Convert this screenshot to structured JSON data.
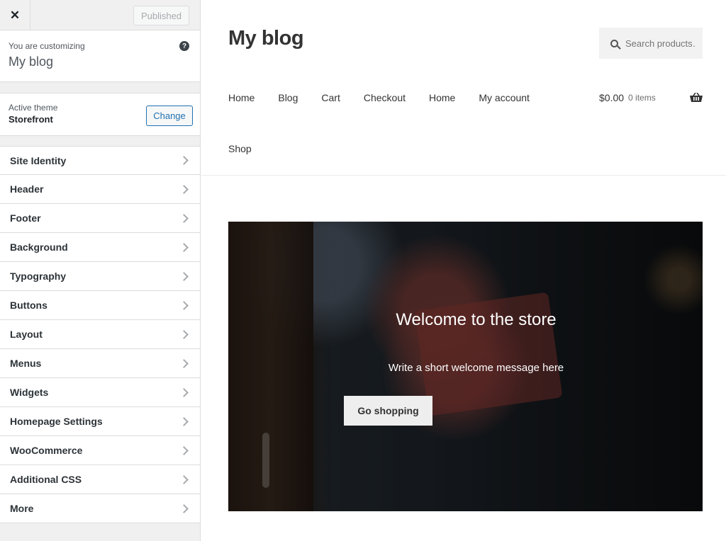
{
  "sidebar": {
    "close_label": "✕",
    "published_label": "Published",
    "customizing_label": "You are customizing",
    "site_name": "My blog",
    "help_label": "?",
    "active_theme_label": "Active theme",
    "theme_name": "Storefront",
    "change_label": "Change",
    "panels": [
      "Site Identity",
      "Header",
      "Footer",
      "Background",
      "Typography",
      "Buttons",
      "Layout",
      "Menus",
      "Widgets",
      "Homepage Settings",
      "WooCommerce",
      "Additional CSS",
      "More"
    ]
  },
  "preview": {
    "site_title": "My blog",
    "search_placeholder": "Search products…",
    "nav": [
      "Home",
      "Blog",
      "Cart",
      "Checkout",
      "Home",
      "My account"
    ],
    "nav_second_row": "Shop",
    "cart_amount": "$0.00",
    "cart_count": "0 items",
    "hero": {
      "title": "Welcome to the store",
      "text": "Write a short welcome message here",
      "button": "Go shopping"
    }
  },
  "colors": {
    "accent": "#2271b1",
    "sidebar_bg": "#f0f0f1"
  }
}
